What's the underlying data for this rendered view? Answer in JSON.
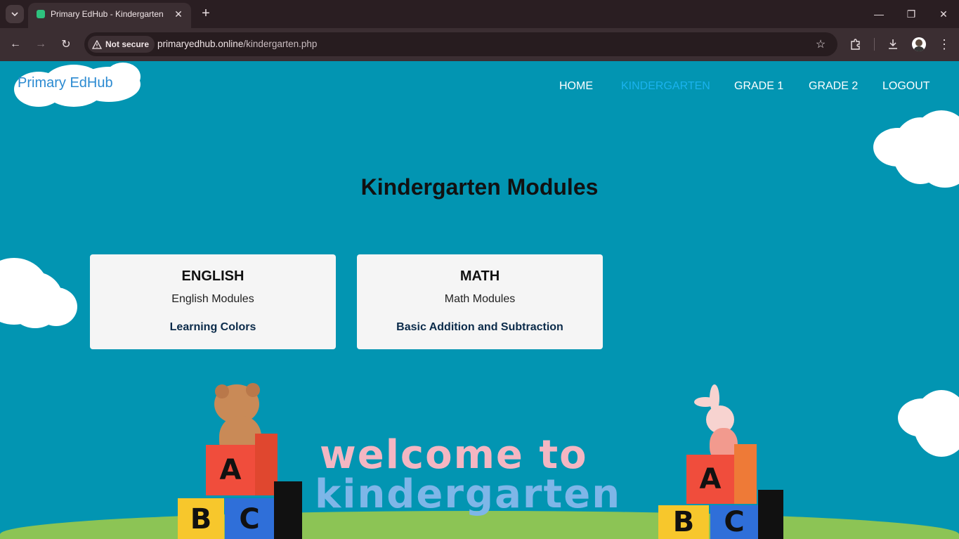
{
  "browser": {
    "tab_title": "Primary EdHub - Kindergarten",
    "security_label": "Not secure",
    "url_host": "primaryedhub.online",
    "url_path": "/kindergarten.php"
  },
  "site": {
    "brand": "Primary EdHub",
    "nav": [
      {
        "label": "HOME"
      },
      {
        "label": "KINDERGARTEN",
        "active": true
      },
      {
        "label": "GRADE 1"
      },
      {
        "label": "GRADE 2"
      },
      {
        "label": "LOGOUT"
      }
    ],
    "heading": "Kindergarten Modules",
    "cards": [
      {
        "title": "ENGLISH",
        "subtitle": "English Modules",
        "link": "Learning Colors"
      },
      {
        "title": "MATH",
        "subtitle": "Math Modules",
        "link": "Basic Addition and Subtraction"
      }
    ],
    "banner": {
      "line1": "welcome to",
      "line2": "kindergarten"
    },
    "blocks": [
      "A",
      "B",
      "C"
    ]
  },
  "colors": {
    "page_bg": "#0295b2",
    "brand": "#2b8ad1",
    "nav_active": "#1ab3ef",
    "card_bg": "#f5f5f5"
  }
}
